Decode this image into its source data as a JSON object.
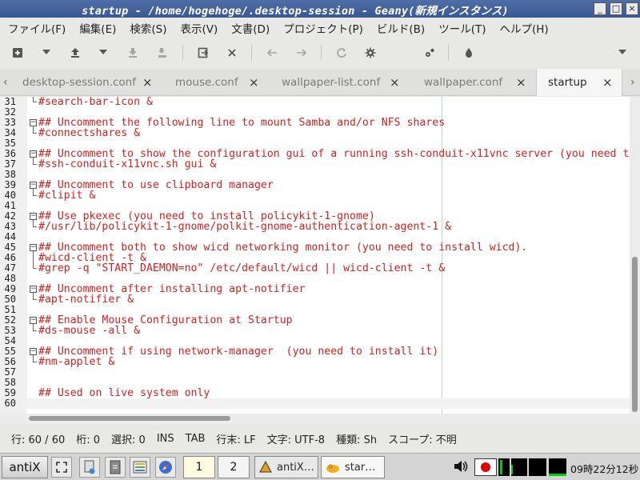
{
  "window": {
    "title": "startup - /home/hogehoge/.desktop-session - Geany(新規インスタンス)",
    "controls": [
      "_",
      "□",
      "×"
    ]
  },
  "menu": [
    "ファイル(F)",
    "編集(E)",
    "検索(S)",
    "表示(V)",
    "文書(D)",
    "プロジェクト(P)",
    "ビルド(B)",
    "ツール(T)",
    "ヘルプ(H)"
  ],
  "toolbar": {
    "icons": [
      "new-file-icon",
      "open-file-icon",
      "save-icon",
      "save-all-icon",
      "revert-icon",
      "close-icon",
      "back-icon",
      "forward-icon",
      "compile-icon",
      "build-icon",
      "run-icon",
      "color-chooser-icon"
    ]
  },
  "tabs": [
    {
      "label": "desktop-session.conf",
      "close": "×"
    },
    {
      "label": "mouse.conf",
      "close": "×"
    },
    {
      "label": "wallpaper-list.conf",
      "close": "×"
    },
    {
      "label": "wallpaper.conf",
      "close": "×"
    },
    {
      "label": "startup",
      "close": "×",
      "active": true
    }
  ],
  "editor": {
    "lines": [
      {
        "n": "31",
        "text": "#search-bar-icon &"
      },
      {
        "n": "32",
        "text": ""
      },
      {
        "n": "33",
        "text": "## Uncomment the following line to mount Samba and/or NFS shares"
      },
      {
        "n": "34",
        "text": "#connectshares &"
      },
      {
        "n": "35",
        "text": ""
      },
      {
        "n": "36",
        "text": "## Uncomment to show the configuration gui of a running ssh-conduit-x11vnc server (you need t"
      },
      {
        "n": "37",
        "text": "#ssh-conduit-x11vnc.sh gui &"
      },
      {
        "n": "38",
        "text": ""
      },
      {
        "n": "39",
        "text": "## Uncomment to use clipboard manager"
      },
      {
        "n": "40",
        "text": "#clipit &"
      },
      {
        "n": "41",
        "text": ""
      },
      {
        "n": "42",
        "text": "## Use pkexec (you need to install policykit-1-gnome)"
      },
      {
        "n": "43",
        "text": "#/usr/lib/policykit-1-gnome/polkit-gnome-authentication-agent-1 &"
      },
      {
        "n": "44",
        "text": ""
      },
      {
        "n": "45",
        "text": "## Uncomment both to show wicd networking monitor (you need to install wicd)."
      },
      {
        "n": "46",
        "text": "#wicd-client -t &"
      },
      {
        "n": "47",
        "text": "#grep -q \"START_DAEMON=no\" /etc/default/wicd || wicd-client -t &"
      },
      {
        "n": "48",
        "text": ""
      },
      {
        "n": "49",
        "text": "## Uncomment after installing apt-notifier"
      },
      {
        "n": "50",
        "text": "#apt-notifier &"
      },
      {
        "n": "51",
        "text": ""
      },
      {
        "n": "52",
        "text": "## Enable Mouse Configuration at Startup"
      },
      {
        "n": "53",
        "text": "#ds-mouse -all &"
      },
      {
        "n": "54",
        "text": ""
      },
      {
        "n": "55",
        "text": "## Uncomment if using network-manager  (you need to install it)"
      },
      {
        "n": "56",
        "text": "#nm-applet &"
      },
      {
        "n": "57",
        "text": ""
      },
      {
        "n": "58",
        "text": ""
      },
      {
        "n": "59",
        "text": "## Used on live system only"
      },
      {
        "n": "60",
        "text": ""
      }
    ]
  },
  "status": {
    "line": "行: 60 / 60",
    "col": "桁: 0",
    "sel": "選択: 0",
    "mode": "INS",
    "indent": "TAB",
    "eol": "行末: LF",
    "encoding": "文字: UTF-8",
    "filetype": "種類: Sh",
    "scope": "スコープ: 不明"
  },
  "taskbar": {
    "start_label": "antiX",
    "pagers": [
      "1",
      "2"
    ],
    "tasks": [
      "antiX…",
      "star…"
    ],
    "clock": "09時22分12秒"
  },
  "colors": {
    "titlebar": "#3d5b95",
    "code_text": "#d32020",
    "edge_line": "#b8e0b8"
  }
}
